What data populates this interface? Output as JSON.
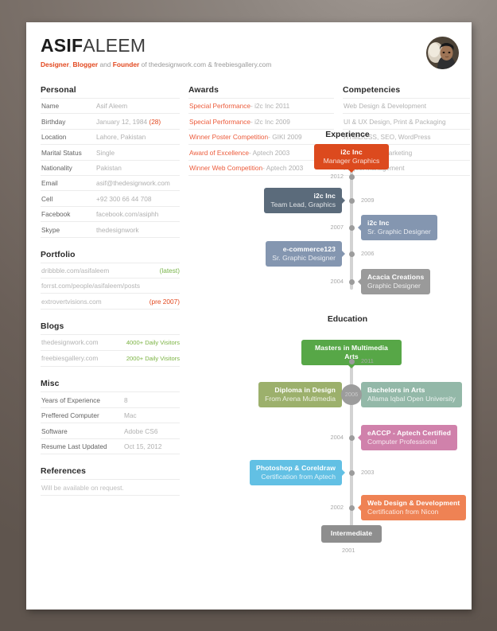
{
  "header": {
    "first_name": "ASIF",
    "last_name": "ALEEM",
    "role_1": "Designer",
    "role_sep_1": ",",
    "role_2": "Blogger",
    "role_join": "and",
    "role_3": "Founder",
    "tagline_tail": "of thedesignwork.com & freebiesgallery.com",
    "avatar_alt": "profile-photo"
  },
  "personal": {
    "title": "Personal",
    "rows": [
      {
        "label": "Name",
        "value": "Asif Aleem"
      },
      {
        "label": "Birthday",
        "value": "January 12, 1984",
        "accent": "(28)"
      },
      {
        "label": "Location",
        "value": "Lahore, Pakistan"
      },
      {
        "label": "Marital Status",
        "value": "Single"
      },
      {
        "label": "Nationality",
        "value": "Pakistan"
      },
      {
        "label": "Email",
        "value": "asif@thedesignwork.com"
      },
      {
        "label": "Cell",
        "value": "+92 300 66 44 708"
      },
      {
        "label": "Facebook",
        "value": "facebook.com/asiphh"
      },
      {
        "label": "Skype",
        "value": "thedesignwork"
      }
    ]
  },
  "portfolio": {
    "title": "Portfolio",
    "rows": [
      {
        "value": "dribbble.com/asifaleem",
        "tag": "(latest)",
        "tag_color": "green"
      },
      {
        "value": "forrst.com/people/asifaleem/posts",
        "tag": "",
        "tag_color": ""
      },
      {
        "value": "extrovertvisions.com",
        "tag": "(pre 2007)",
        "tag_color": "orange"
      }
    ]
  },
  "blogs": {
    "title": "Blogs",
    "rows": [
      {
        "value": "thedesignwork.com",
        "tag": "4000+ Daily Visitors",
        "tag_color": "green-b"
      },
      {
        "value": "freebiesgallery.com",
        "tag": "2000+ Daily Visitors",
        "tag_color": "green-b"
      }
    ]
  },
  "misc": {
    "title": "Misc",
    "rows": [
      {
        "label": "Years of Experience",
        "value": "8"
      },
      {
        "label": "Preffered Computer",
        "value": "Mac"
      },
      {
        "label": "Software",
        "value": "Adobe CS6"
      },
      {
        "label": "Resume Last Updated",
        "value": "Oct 15, 2012"
      }
    ]
  },
  "references": {
    "title": "References",
    "note": "Will be available on request."
  },
  "awards": {
    "title": "Awards",
    "rows": [
      {
        "name": "Special Performance",
        "meta": " - i2c Inc 2011"
      },
      {
        "name": "Special Performance",
        "meta": " - i2c Inc 2009"
      },
      {
        "name": "Winner Poster Competition",
        "meta": " - GIKI 2009"
      },
      {
        "name": "Award of Excellence",
        "meta": " - Aptech 2003"
      },
      {
        "name": "Winner Web Competition",
        "meta": " - Aptech 2003"
      }
    ]
  },
  "competencies": {
    "title": "Competencies",
    "rows": [
      "Web Design & Development",
      "UI & UX Design, Print & Packaging",
      "HTML/CSS, SEO, WordPress",
      "Social Media Marketing",
      "Project Management"
    ]
  },
  "experience": {
    "title": "Experience",
    "items": [
      {
        "t1": "i2c Inc",
        "t2": "Manager Graphics",
        "color": "#dc4a1e",
        "side": "top",
        "year": "2012"
      },
      {
        "t1": "i2c Inc",
        "t2": "Team Lead, Graphics",
        "color": "#5b6b7b",
        "side": "left",
        "year": "2009"
      },
      {
        "t1": "i2c Inc",
        "t2": "Sr. Graphic Designer",
        "color": "#8496b0",
        "side": "right",
        "year": "2007"
      },
      {
        "t1": "e-commerce123",
        "t2": "Sr. Graphic Designer",
        "color": "#8496b0",
        "side": "left",
        "year": "2006"
      },
      {
        "t1": "Acacia Creations",
        "t2": "Graphic Designer",
        "color": "#9a9a9a",
        "side": "right",
        "year": "2004"
      }
    ]
  },
  "education": {
    "title": "Education",
    "items": [
      {
        "t1": "Masters in Multimedia Arts",
        "t2": "",
        "color": "#57a747",
        "side": "top",
        "year": "2011"
      },
      {
        "t1": "Diploma in Design",
        "t2": "From Arena Multimedia",
        "color": "#9cb06c",
        "side": "left",
        "year": ""
      },
      {
        "t1": "Bachelors in Arts",
        "t2": "Allama Iqbal Open University",
        "color": "#93b8a8",
        "side": "right",
        "year": ""
      },
      {
        "t1": "eACCP - Aptech Certified",
        "t2": "Computer Professional",
        "color": "#d081ab",
        "side": "right",
        "year": "2004"
      },
      {
        "t1": "Photoshop & Coreldraw",
        "t2": "Certification from Aptech",
        "color": "#62c0e4",
        "side": "left",
        "year": "2003"
      },
      {
        "t1": "Web Design & Development",
        "t2": "Certification from Nicon",
        "color": "#ef8254",
        "side": "right",
        "year": "2002"
      },
      {
        "t1": "Intermediate",
        "t2": "",
        "color": "#8e8e8e",
        "side": "bottom",
        "year": "2001"
      }
    ],
    "bubble_year": "2006"
  },
  "colors": {
    "accent_orange": "#e2481f",
    "accent_green": "#79b44a",
    "paper": "#ffffff",
    "canvas": "#6e635c",
    "rule": "#ececec",
    "spine": "#d3d3d3"
  }
}
